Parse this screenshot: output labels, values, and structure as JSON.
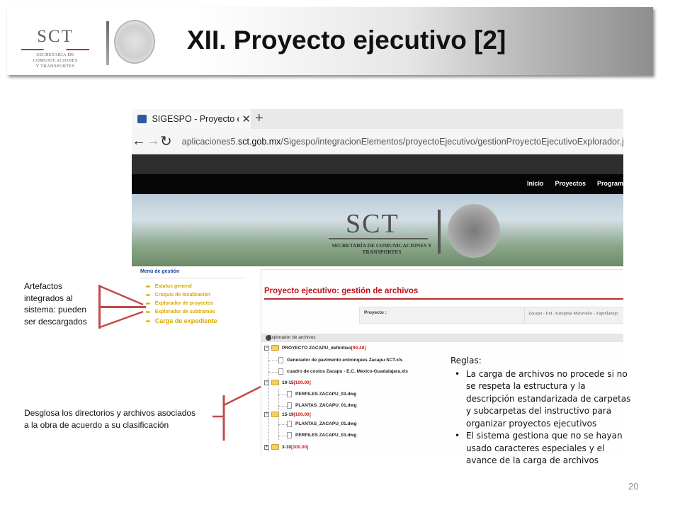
{
  "slide": {
    "title": "XII. Proyecto ejecutivo [2]",
    "page_number": "20"
  },
  "logo": {
    "sct": "SCT",
    "line1": "SECRETARÍA DE",
    "line2": "COMUNICACIONES",
    "line3": "Y TRANSPORTES"
  },
  "browser": {
    "tab_title": "SIGESPO - Proyecto ejec",
    "tab_close": "✕",
    "new_tab": "+",
    "back": "←",
    "forward": "→",
    "refresh": "↻",
    "url_prefix": "aplicaciones5.",
    "url_domain": "sct.gob.mx",
    "url_path": "/Sigespo/integracionElementos/proyectoEjecutivo/gestionProyectoEjecutivoExplorador.jsf"
  },
  "site": {
    "nav": [
      "Inicio",
      "Proyectos",
      "Program"
    ],
    "banner_sct": "SCT",
    "banner_sub": "SECRETARÍA DE COMUNICACIONES Y TRANSPORTES"
  },
  "menu": {
    "title": "Menú de gestión",
    "items": [
      "Estatus general",
      "Croquis de localización",
      "Explorador de proyectos",
      "Explorador de subtramos",
      "Carga de expediente"
    ]
  },
  "panel": {
    "title": "Proyecto ejecutivo: gestión de archivos",
    "project_label": "Proyecto :",
    "project_value": "Zacapu - Ent. Autopista Maravatío - Zapotlanejo",
    "explorer_title": "Explorador de archivos"
  },
  "tree": {
    "root_name": "PROYECTO ZACAPU_definitivo ",
    "root_pct": "[99.48]",
    "file1": "Generador de pavimento entronques Zacapu SCT.xls",
    "file2": "cuadro de costos Zacapu - E.C. Mexico-Guadalajara.xls",
    "folder1_name": "10-15 ",
    "folder1_pct": "[100.00]",
    "f1_a": "PERFILES ZACAPU_03.dwg",
    "f1_b": "PLANTAS_ZACAPU_01.dwg",
    "folder2_name": "15-19 ",
    "folder2_pct": "[100.00]",
    "f2_a": "PLANTAS_ZACAPU_01.dwg",
    "f2_b": "PERFILES ZACAPU_03.dwg",
    "folder3_name": "3-10 ",
    "folder3_pct": "[100.00]"
  },
  "notes": {
    "artefactos": [
      "Artefactos",
      "integrados al",
      "sistema: pueden",
      "ser descargados"
    ],
    "desglosa": [
      "Desglosa los directorios y archivos asociados",
      "a la obra de acuerdo a su clasificación"
    ]
  },
  "rules": {
    "heading": "Reglas:",
    "rule1": "La carga de archivos no procede si no se respeta la estructura y la descripción estandarizada de carpetas y subcarpetas del instructivo para organizar proyectos ejecutivos",
    "rule2": "El sistema gestiona que no se hayan usado caracteres especiales y el avance de la carga de archivos"
  },
  "colors": {
    "accent_red": "#c0101a",
    "menu_yellow": "#d9a800",
    "callout_red": "#c04a4a"
  }
}
